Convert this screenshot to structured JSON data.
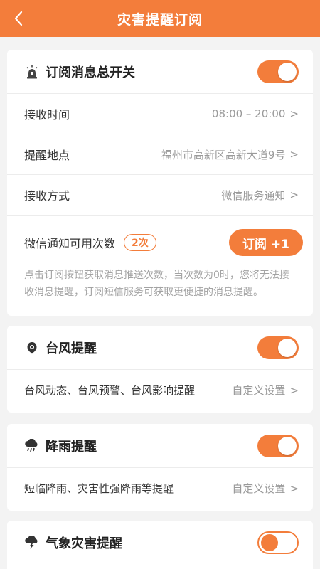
{
  "header": {
    "title": "灾害提醒订阅",
    "back_icon": "back-chevron-icon"
  },
  "colors": {
    "accent": "#f37d3b"
  },
  "master": {
    "title": "订阅消息总开关",
    "icon": "alarm-light-icon",
    "toggle_on": true,
    "rows": [
      {
        "label": "接收时间",
        "value": "08:00 – 20:00"
      },
      {
        "label": "提醒地点",
        "value": "福州市高新区高新大道9号"
      },
      {
        "label": "接收方式",
        "value": "微信服务通知"
      }
    ],
    "count_label": "微信通知可用次数",
    "count_badge": "2次",
    "subscribe_button": "订阅 +1",
    "note": "点击订阅按钮获取消息推送次数，当次数为0时，您将无法接收消息提醒，订阅短信服务可获取更便捷的消息提醒。"
  },
  "sections": [
    {
      "title": "台风提醒",
      "icon": "typhoon-icon",
      "toggle_on": true,
      "desc": "台风动态、台风预警、台风影响提醒",
      "action": "自定义设置"
    },
    {
      "title": "降雨提醒",
      "icon": "rain-cloud-icon",
      "toggle_on": true,
      "desc": "短临降雨、灾害性强降雨等提醒",
      "action": "自定义设置"
    },
    {
      "title": "气象灾害提醒",
      "icon": "thunderstorm-icon",
      "toggle_on": false
    }
  ],
  "chevron": ">"
}
